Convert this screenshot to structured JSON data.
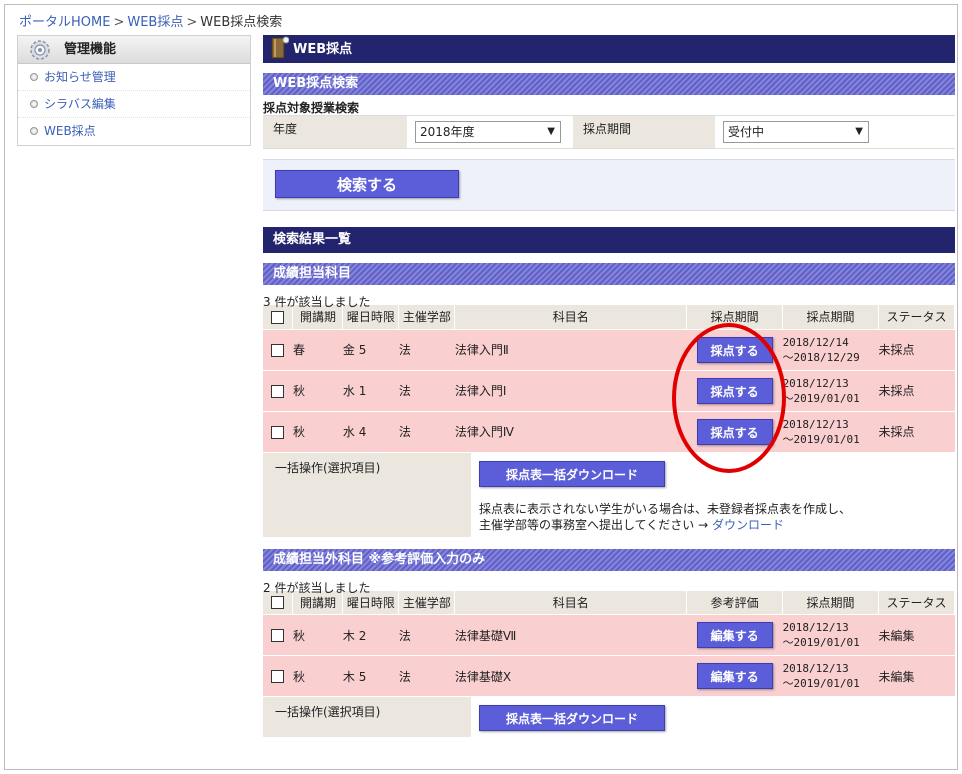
{
  "breadcrumb": {
    "home": "ポータルHOME",
    "sep": ">",
    "mid": "WEB採点",
    "current": "WEB採点検索"
  },
  "sidebar": {
    "title": "管理機能",
    "items": [
      {
        "label": "お知らせ管理"
      },
      {
        "label": "シラバス編集"
      },
      {
        "label": "WEB採点"
      }
    ]
  },
  "main": {
    "title": "WEB採点",
    "search_header": "WEB採点検索",
    "search_sub": "採点対象授業検索",
    "year_label": "年度",
    "year_value": "2018年度",
    "period_label": "採点期間",
    "period_value": "受付中",
    "search_button": "検索する",
    "results_header": "検索結果一覧"
  },
  "assigned": {
    "header": "成績担当科目",
    "count": "3 件が該当しました",
    "columns": [
      "開講期",
      "曜日時限",
      "主催学部",
      "科目名",
      "採点期間",
      "採点期間",
      "ステータス"
    ],
    "rows": [
      {
        "term": "春",
        "slot": "金 5",
        "faculty": "法",
        "subject": "法律入門Ⅱ",
        "button": "採点する",
        "period_from": "2018/12/14",
        "period_to": "～2018/12/29",
        "status": "未採点"
      },
      {
        "term": "秋",
        "slot": "水 1",
        "faculty": "法",
        "subject": "法律入門Ⅰ",
        "button": "採点する",
        "period_from": "2018/12/13",
        "period_to": "～2019/01/01",
        "status": "未採点"
      },
      {
        "term": "秋",
        "slot": "水 4",
        "faculty": "法",
        "subject": "法律入門Ⅳ",
        "button": "採点する",
        "period_from": "2018/12/13",
        "period_to": "～2019/01/01",
        "status": "未採点"
      }
    ],
    "bulk_label": "一括操作(選択項目)",
    "bulk_button": "採点表一括ダウンロード",
    "note_line1": "採点表に表示されない学生がいる場合は、未登録者採点表を作成し、",
    "note_line2": "主催学部等の事務室へ提出してください →",
    "note_link": "ダウンロード"
  },
  "other": {
    "header": "成績担当外科目 ※参考評価入力のみ",
    "count": "2 件が該当しました",
    "columns": [
      "開講期",
      "曜日時限",
      "主催学部",
      "科目名",
      "参考評価",
      "採点期間",
      "ステータス"
    ],
    "rows": [
      {
        "term": "秋",
        "slot": "木 2",
        "faculty": "法",
        "subject": "法律基礎Ⅶ",
        "button": "編集する",
        "period_from": "2018/12/13",
        "period_to": "～2019/01/01",
        "status": "未編集"
      },
      {
        "term": "秋",
        "slot": "木 5",
        "faculty": "法",
        "subject": "法律基礎Ⅹ",
        "button": "編集する",
        "period_from": "2018/12/13",
        "period_to": "～2019/01/01",
        "status": "未編集"
      }
    ],
    "bulk_label": "一括操作(選択項目)",
    "bulk_button": "採点表一括ダウンロード"
  },
  "colors": {
    "navy": "#22246e",
    "stripe": "#6a6ad0",
    "row_pink": "#f9cfd0",
    "button": "#5b5ed8",
    "highlight": "#e00000"
  }
}
